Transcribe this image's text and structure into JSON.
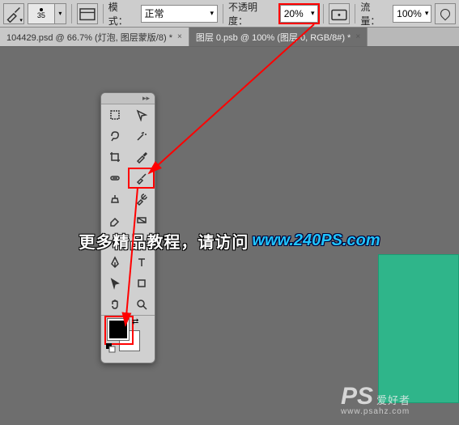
{
  "options": {
    "brush_size": "35",
    "mode_label": "模式：",
    "mode_value": "正常",
    "opacity_label": "不透明度：",
    "opacity_value": "20%",
    "flow_label": "流量：",
    "flow_value": "100%"
  },
  "tabs": [
    {
      "label": "104429.psd @ 66.7% (灯泡, 图层蒙版/8) *",
      "close": "×",
      "active": false
    },
    {
      "label": "图层 0.psb @ 100% (图层 0, RGB/8#) *",
      "close": "×",
      "active": true
    }
  ],
  "tools_panel": {
    "header_glyph": "▸▸",
    "tools": [
      [
        "move-tool",
        "rect-marquee-tool"
      ],
      [
        "lasso-tool",
        "magic-wand-tool"
      ],
      [
        "crop-tool",
        "eyedropper-tool"
      ],
      [
        "healing-brush-tool",
        "brush-tool"
      ],
      [
        "clone-stamp-tool",
        "history-brush-tool"
      ],
      [
        "eraser-tool",
        "gradient-tool"
      ],
      [
        "blur-tool",
        "dodge-tool"
      ],
      [
        "pen-tool",
        "type-tool"
      ],
      [
        "path-select-tool",
        "shape-tool"
      ],
      [
        "hand-tool",
        "zoom-tool"
      ]
    ],
    "swap_glyph": "⇄"
  },
  "watermark": {
    "text": "更多精品教程，请访问",
    "link": "www.240PS.com"
  },
  "logo": {
    "main": "PS",
    "sub": "爱好者",
    "url": "www.psahz.com"
  },
  "colors": {
    "highlight": "#ff0000",
    "canvas_bg": "#6e6e6e",
    "green": "#2fb58a"
  }
}
